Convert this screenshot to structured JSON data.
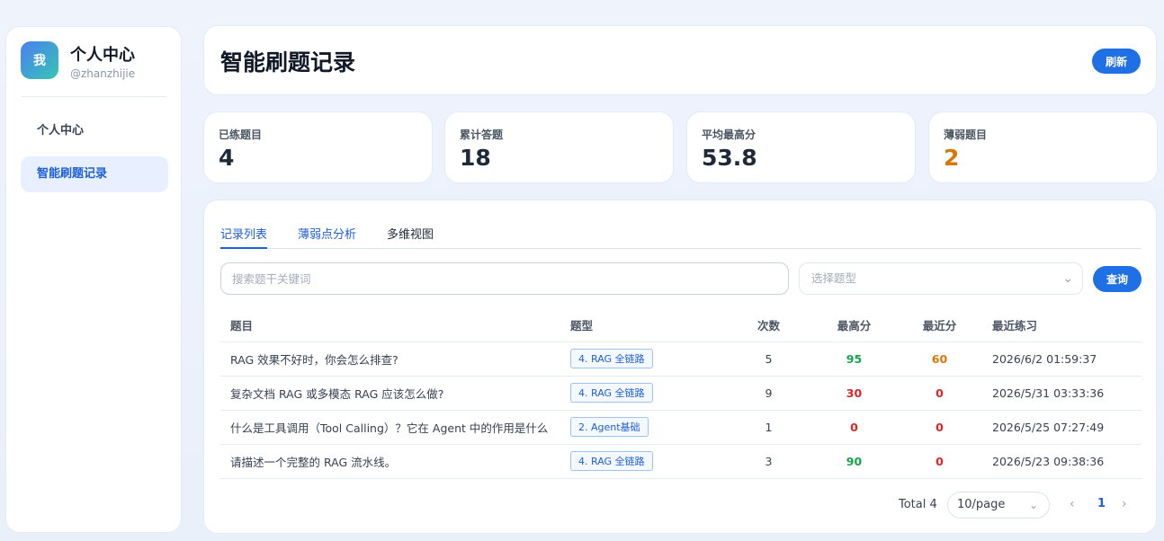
{
  "sidebar": {
    "avatar_text": "我",
    "name": "个人中心",
    "handle": "@zhanzhijie",
    "items": [
      {
        "label": "个人中心"
      },
      {
        "label": "智能刷题记录"
      }
    ]
  },
  "header": {
    "title": "智能刷题记录",
    "refresh_label": "刷新"
  },
  "stats": [
    {
      "label": "已练题目",
      "value": "4"
    },
    {
      "label": "累计答题",
      "value": "18"
    },
    {
      "label": "平均最高分",
      "value": "53.8"
    },
    {
      "label": "薄弱题目",
      "value": "2"
    }
  ],
  "tabs": [
    {
      "label": "记录列表"
    },
    {
      "label": "薄弱点分析"
    },
    {
      "label": "多维视图"
    }
  ],
  "filters": {
    "search_placeholder": "搜索题干关键词",
    "type_placeholder": "选择题型",
    "query_label": "查询"
  },
  "table": {
    "headers": [
      "题目",
      "题型",
      "次数",
      "最高分",
      "最近分",
      "最近练习"
    ],
    "rows": [
      {
        "title": "RAG 效果不好时，你会怎么排查?",
        "type": "4. RAG 全链路",
        "count": "5",
        "best": "95",
        "recent": "60",
        "date": "2026/6/2 01:59:37"
      },
      {
        "title": "复杂文档 RAG 或多模态 RAG 应该怎么做?",
        "type": "4. RAG 全链路",
        "count": "9",
        "best": "30",
        "recent": "0",
        "date": "2026/5/31 03:33:36"
      },
      {
        "title": "什么是工具调用（Tool Calling）？它在 Agent 中的作用是什么",
        "type": "2. Agent基础",
        "count": "1",
        "best": "0",
        "recent": "0",
        "date": "2026/5/25 07:27:49"
      },
      {
        "title": "请描述一个完整的 RAG 流水线。",
        "type": "4. RAG 全链路",
        "count": "3",
        "best": "90",
        "recent": "0",
        "date": "2026/5/23 09:38:36"
      }
    ]
  },
  "pagination": {
    "total": "Total 4",
    "page_size": "10/page",
    "current_page": "1"
  },
  "colors": {
    "primary": "#1f6fe5",
    "good": "#16a34a",
    "bad": "#dc2626",
    "warn": "#d97706"
  }
}
